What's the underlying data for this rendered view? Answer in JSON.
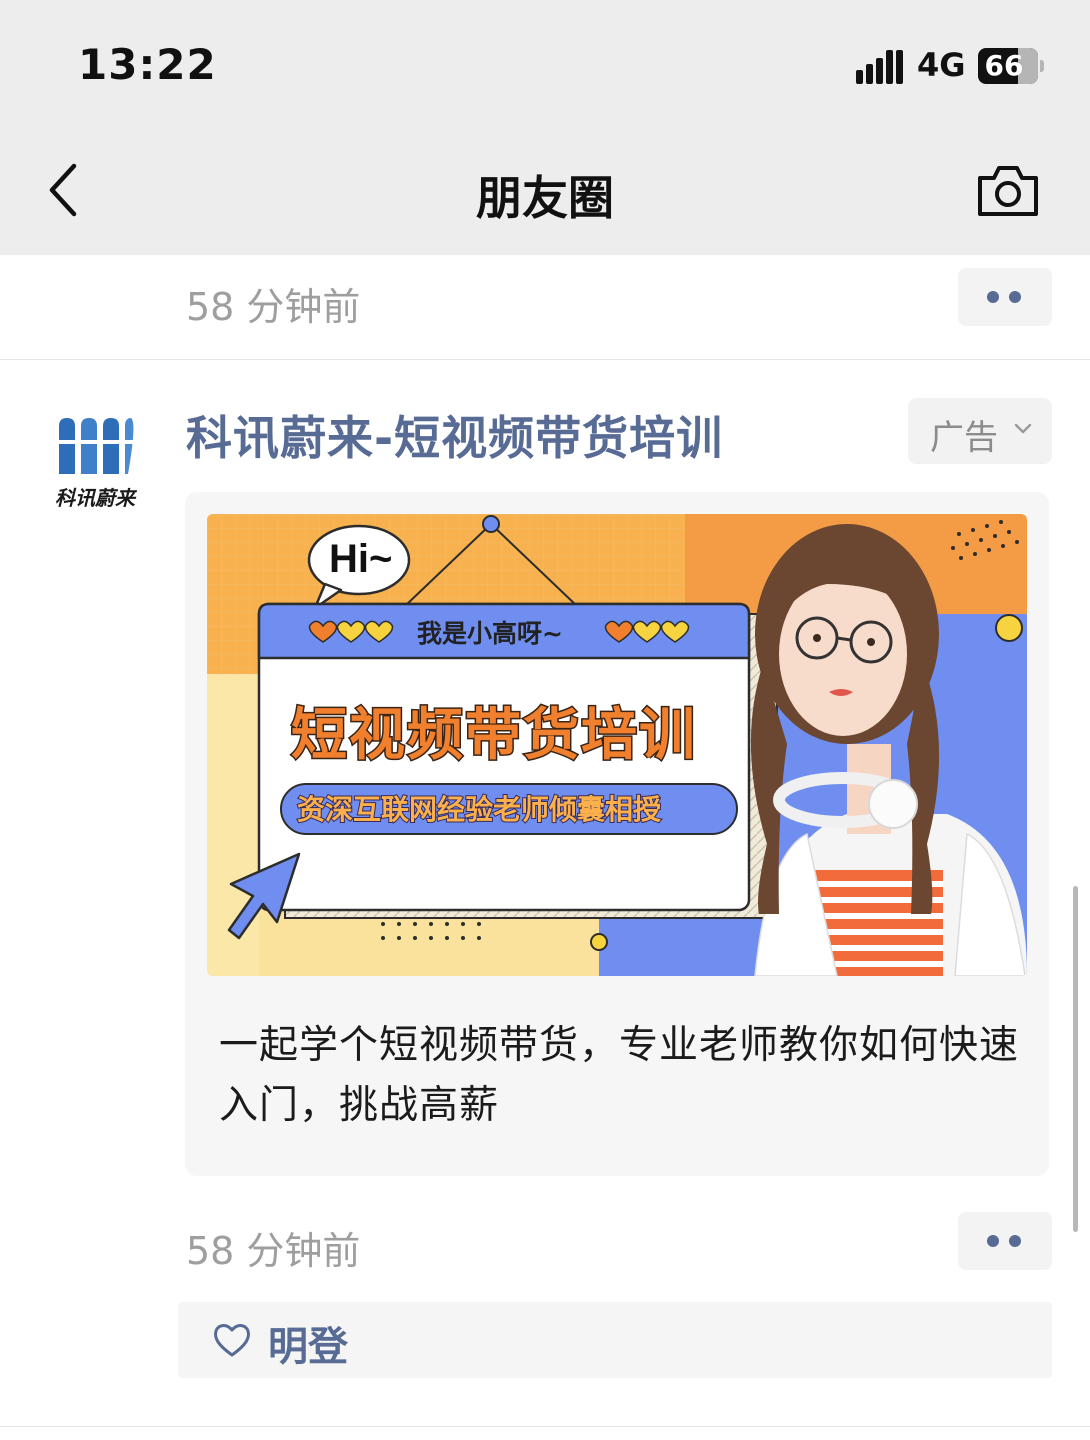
{
  "status_bar": {
    "time": "13:22",
    "network": "4G",
    "battery": "66"
  },
  "nav": {
    "title": "朋友圈"
  },
  "prev_post": {
    "time": "58 分钟前"
  },
  "ad_post": {
    "advertiser": "科讯蔚来-短视频带货培训",
    "avatar_text": "科讯蔚来",
    "ad_label": "广告",
    "banner": {
      "greeting": "Hi~",
      "host": "我是小高呀~",
      "headline": "短视频带货培训",
      "subline": "资深互联网经验老师倾囊相授"
    },
    "description": "一起学个短视频带货，专业老师教你如何快速入门，挑战高薪",
    "time": "58 分钟前",
    "likes": [
      "明登"
    ]
  },
  "colors": {
    "link_blue": "#576b95",
    "nav_bg": "#ededed",
    "time_gray": "#9e9e9e",
    "banner_orange": "#f49b45"
  },
  "icons": [
    "back-chevron",
    "camera",
    "more-dots",
    "chevron-down",
    "heart-outline",
    "signal-bars"
  ]
}
